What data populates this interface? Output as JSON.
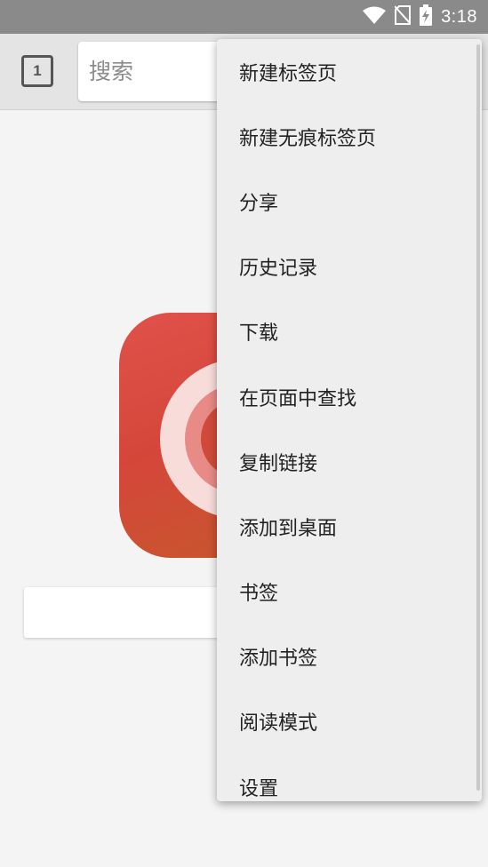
{
  "status_bar": {
    "time": "3:18",
    "icons": [
      "wifi-icon",
      "no-sim-icon",
      "battery-charging-icon"
    ],
    "background": "#8a8a8a"
  },
  "toolbar": {
    "tab_count": "1",
    "search_placeholder": "搜索"
  },
  "menu": {
    "items": [
      {
        "label": "新建标签页"
      },
      {
        "label": "新建无痕标签页"
      },
      {
        "label": "分享"
      },
      {
        "label": "历史记录"
      },
      {
        "label": "下载"
      },
      {
        "label": "在页面中查找"
      },
      {
        "label": "复制链接"
      },
      {
        "label": "添加到桌面"
      },
      {
        "label": "书签"
      },
      {
        "label": "添加书签"
      },
      {
        "label": "阅读模式"
      },
      {
        "label": "设置"
      }
    ]
  },
  "colors": {
    "logo_primary": "#d5463a",
    "logo_secondary": "#c45a2b",
    "menu_background": "#eeeeee",
    "toolbar_background": "#e4e4e4"
  }
}
